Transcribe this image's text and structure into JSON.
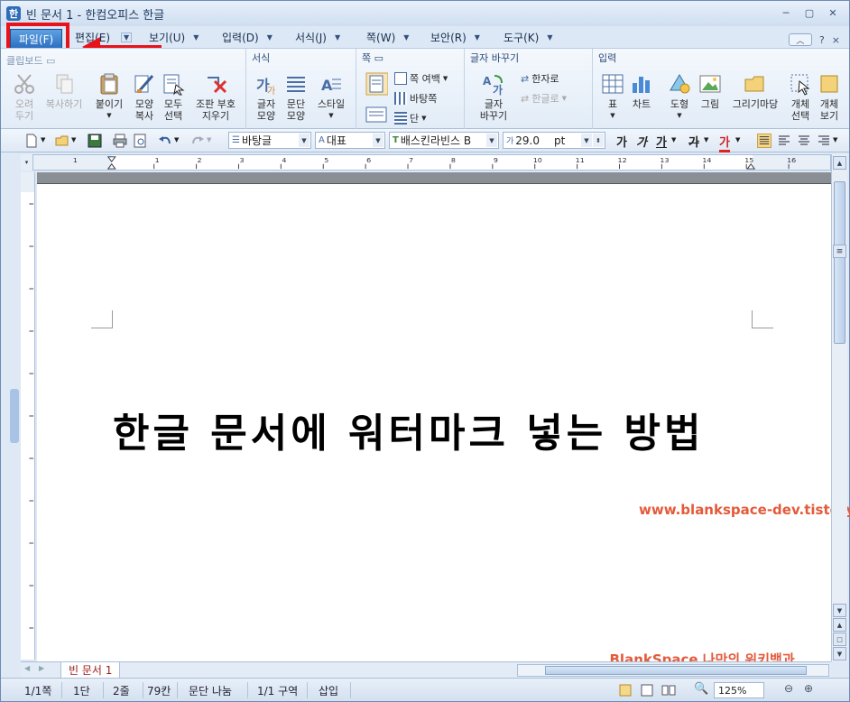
{
  "window": {
    "title": "빈 문서 1 - 한컴오피스 한글",
    "icon_glyph": "한",
    "controls": [
      "─",
      "▢",
      "✕"
    ]
  },
  "menubar": {
    "items": [
      {
        "label": "파일(F)"
      },
      {
        "label": "편집(E)"
      },
      {
        "label": "보기(U)"
      },
      {
        "label": "입력(D)"
      },
      {
        "label": "서식(J)"
      },
      {
        "label": "쪽(W)"
      },
      {
        "label": "보안(R)"
      },
      {
        "label": "도구(K)"
      }
    ],
    "right": {
      "toggle": "︿",
      "help": "?",
      "close": "×"
    }
  },
  "ribbon": {
    "groups": {
      "clipboard": {
        "title": "클립보드 ▭"
      },
      "format": {
        "title": "서식"
      },
      "page": {
        "title": "쪽 ▭"
      },
      "convert": {
        "title": "글자 바꾸기"
      },
      "insert": {
        "title": "입력"
      }
    },
    "buttons": {
      "cut": "오려\n두기",
      "copy": "복사하기",
      "paste": "붙이기",
      "format_copy": "모양\n복사",
      "select_all": "모두\n선택",
      "clear_marks": "조판 부호\n지우기",
      "char_shape": "글자\n모양",
      "para_shape": "문단\n모양",
      "style": "스타일",
      "page_layout": "쪽 여백",
      "background": "바탕쪽",
      "columns": "단",
      "change_char": "글자\n바꾸기",
      "to_hanja": "한자로",
      "to_hangul": "한글로",
      "table": "표",
      "chart": "차트",
      "shape": "도형",
      "picture": "그림",
      "drawing": "그리기마당",
      "object_select": "개체\n선택",
      "object_save": "개체\n보기"
    }
  },
  "format_toolbar": {
    "style_value": "바탕글",
    "language_value": "대표",
    "font_value": "배스킨라빈스 B",
    "size_value": "29.0",
    "size_unit": "pt",
    "bold_glyph": "가",
    "italic_glyph": "가",
    "underline_glyph": "가",
    "strike_glyph": "가",
    "color_glyph": "가"
  },
  "document": {
    "heading": "한글 문서에 워터마크 넣는 방법",
    "watermark_line1": "_BlankSpace 나만의 위키백과",
    "watermark_line2": "www.blankspace-dev.tistory.com"
  },
  "tabs": {
    "active": "빈 문서 1"
  },
  "statusbar": {
    "page": "1/1쪽",
    "column": "1단",
    "line": "2줄",
    "char": "79칸",
    "para": "문단 나눔",
    "section": "1/1 구역",
    "mode": "삽입",
    "zoom": "125%"
  },
  "colors": {
    "accent": "#2d6fc1",
    "highlight": "#e8121b",
    "watermark": "#e45a3a"
  }
}
